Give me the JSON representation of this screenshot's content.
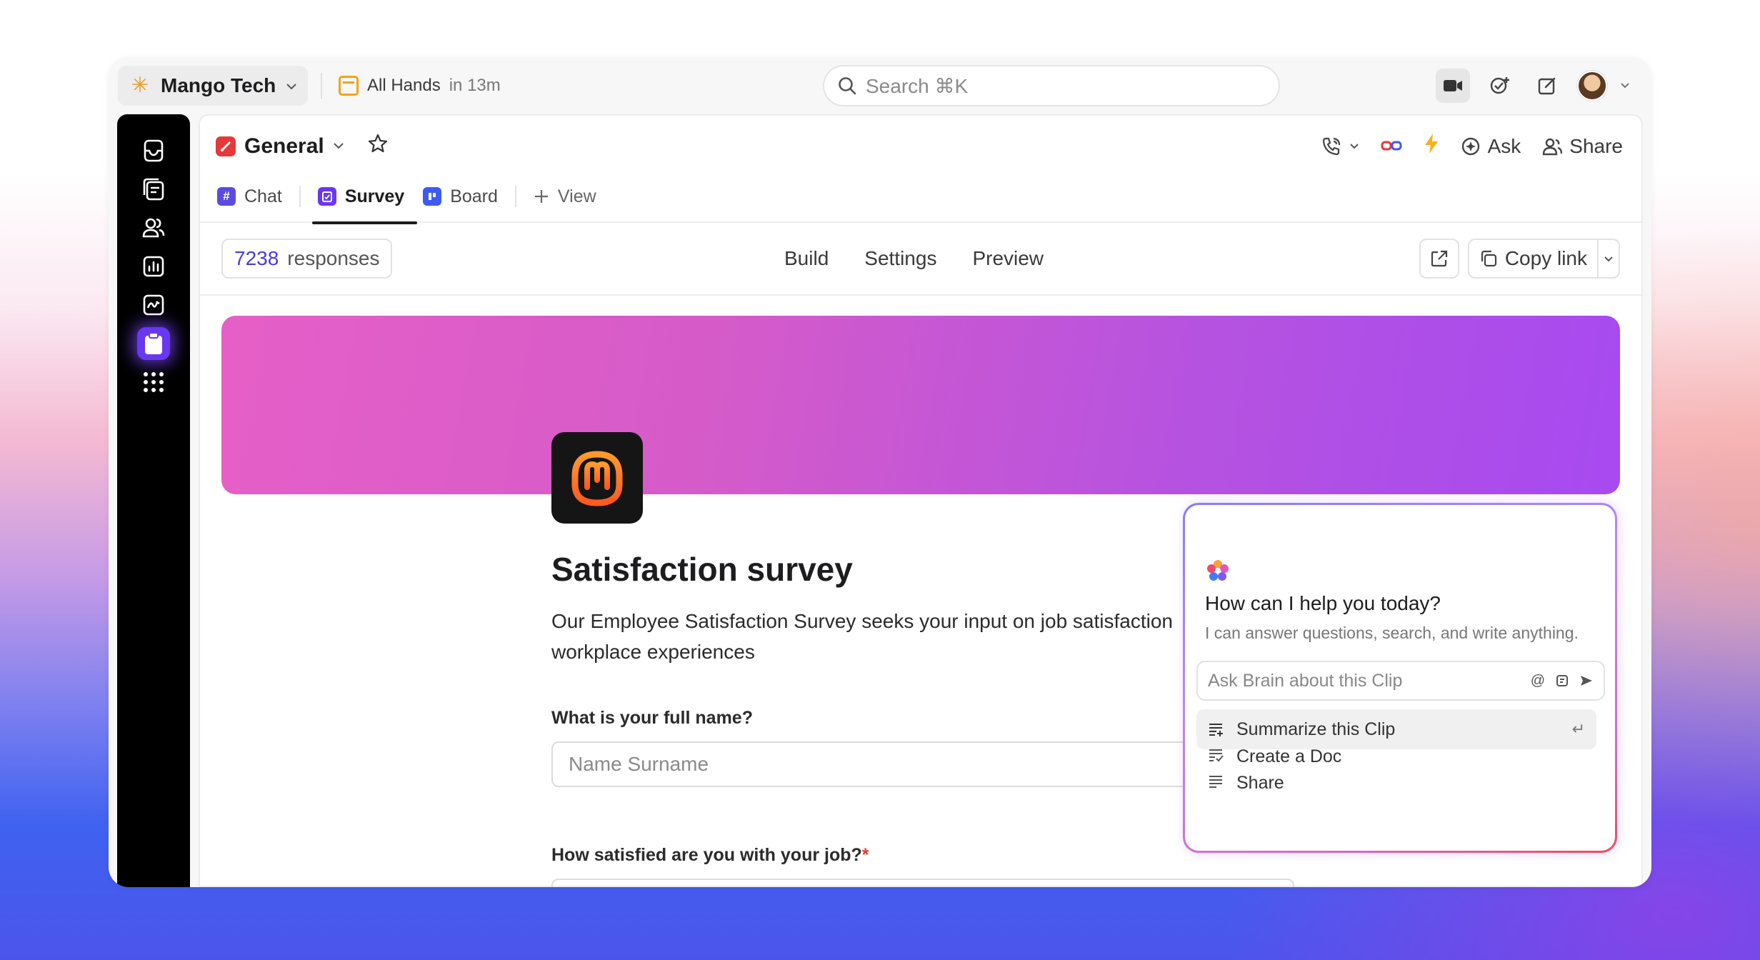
{
  "workspace": {
    "name": "Mango Tech"
  },
  "meeting": {
    "title": "All Hands",
    "when": "in 13m"
  },
  "search": {
    "placeholder": "Search ⌘K"
  },
  "channel": {
    "name": "General"
  },
  "header_actions": {
    "ask": "Ask",
    "share": "Share"
  },
  "tabs": [
    {
      "label": "Chat",
      "icon": "hash-icon",
      "color": "#5b4be0"
    },
    {
      "label": "Survey",
      "icon": "clipboard-icon",
      "color": "#6a37f0"
    },
    {
      "label": "Board",
      "icon": "board-icon",
      "color": "#3d5bf2"
    },
    {
      "label": "View",
      "icon": "plus-icon"
    }
  ],
  "survey_toolbar": {
    "response_count": "7238",
    "response_label": "responses",
    "nav": [
      "Build",
      "Settings",
      "Preview"
    ],
    "copy_link": "Copy link"
  },
  "form": {
    "title": "Satisfaction survey",
    "description": "Our Employee Satisfaction Survey seeks your input on job satisfaction",
    "description_line2": "workplace experiences",
    "q1": {
      "label": "What is your full name?",
      "placeholder": "Name Surname"
    },
    "q2": {
      "label": "How satisfied are you with your job?",
      "required_mark": "*"
    }
  },
  "brain": {
    "title": "How can I help you today?",
    "subtitle": "I can answer questions, search, and write anything.",
    "input_placeholder": "Ask Brain about this Clip",
    "options": [
      "Summarize this Clip",
      "Create a Doc",
      "Share"
    ]
  },
  "colors": {
    "accent": "#6a37f0",
    "banner_start": "#e65fc7",
    "banner_end": "#a74af0",
    "required": "#e5383b"
  }
}
